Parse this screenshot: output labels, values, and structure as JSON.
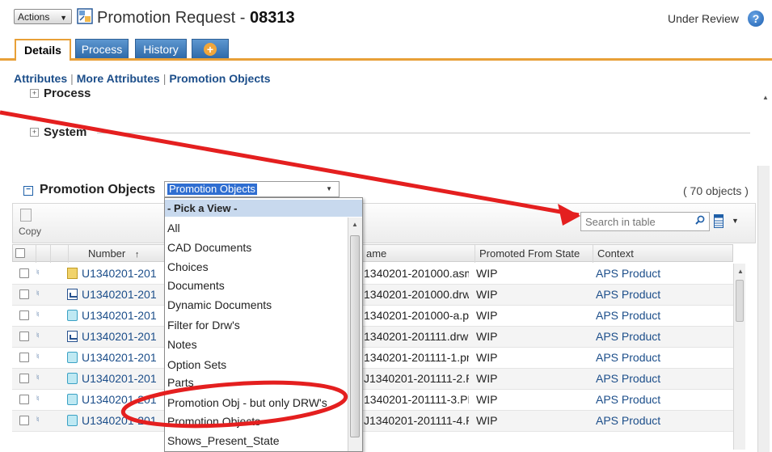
{
  "header": {
    "actions_label": "Actions",
    "title_prefix": "Promotion Request - ",
    "title_number": "08313",
    "status": "Under Review"
  },
  "tabs": [
    {
      "label": "Details"
    },
    {
      "label": "Process"
    },
    {
      "label": "History"
    }
  ],
  "subnav": {
    "attributes": "Attributes",
    "more_attributes": "More Attributes",
    "promotion_objects": "Promotion Objects"
  },
  "sections": {
    "process": "Process",
    "system": "System"
  },
  "promotion": {
    "title": "Promotion Objects",
    "selected_view": "Promotion Objects",
    "count": "( 70 objects )",
    "copy_label": "Copy",
    "search_placeholder": "Search in table"
  },
  "columns": {
    "number": "Number",
    "sort_indicator": "↑",
    "name": "ame",
    "state": "Promoted From State",
    "context": "Context"
  },
  "rows": [
    {
      "number": "U1340201-201",
      "name": "1340201-201000.asm",
      "state": "WIP",
      "context": "APS Product",
      "type": "asm"
    },
    {
      "number": "U1340201-201",
      "name": "1340201-201000.drw",
      "state": "WIP",
      "context": "APS Product",
      "type": "drw"
    },
    {
      "number": "U1340201-201",
      "name": "1340201-201000-a.prt",
      "state": "WIP",
      "context": "APS Product",
      "type": "prt"
    },
    {
      "number": "U1340201-201",
      "name": "1340201-201111.drw",
      "state": "WIP",
      "context": "APS Product",
      "type": "drw"
    },
    {
      "number": "U1340201-201",
      "name": "1340201-201111-1.prt",
      "state": "WIP",
      "context": "APS Product",
      "type": "prt"
    },
    {
      "number": "U1340201-201",
      "name": "J1340201-201111-2.P...",
      "state": "WIP",
      "context": "APS Product",
      "type": "prt"
    },
    {
      "number": "U1340201-201",
      "name": "1340201-201111-3.PRT",
      "state": "WIP",
      "context": "APS Product",
      "type": "prt"
    },
    {
      "number": "U1340201-201",
      "name": "J1340201-201111-4.P...",
      "state": "WIP",
      "context": "APS Product",
      "type": "prt"
    }
  ],
  "dropdown": {
    "header": "- Pick a View -",
    "items": [
      "All",
      "CAD Documents",
      "Choices",
      "Documents",
      "Dynamic Documents",
      "Filter for Drw's",
      "Notes",
      "Option Sets",
      "Parts",
      "Promotion Obj - but only DRW's",
      "Promotion Objects",
      "Shows_Present_State"
    ]
  },
  "colors": {
    "tab_blue": "#2f6aa9",
    "tab_accent": "#e8a038",
    "link": "#1c4e8a",
    "annotation_red": "#e41f1f"
  }
}
